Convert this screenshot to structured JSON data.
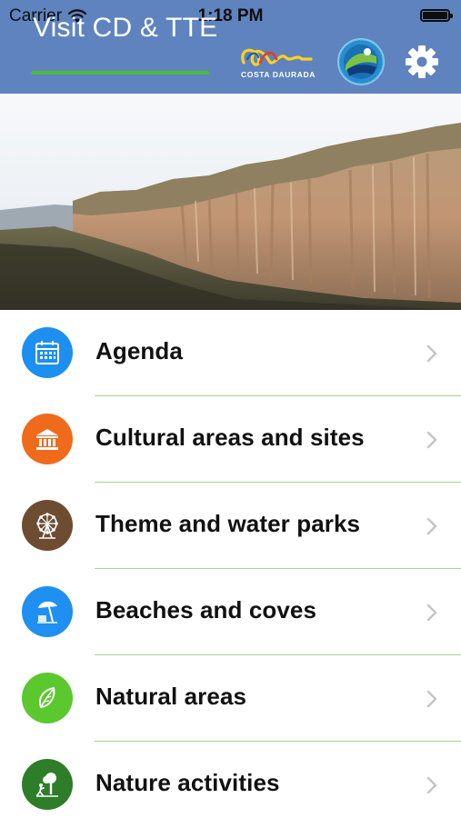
{
  "status_bar": {
    "carrier": "Carrier",
    "time": "1:18 PM"
  },
  "nav": {
    "title": "Visit CD & TTE",
    "logo_text": "COSTA DAURADA",
    "settings_icon": "gear-icon"
  },
  "hero": {
    "image": "rocky-cliff-landscape"
  },
  "menu": {
    "items": [
      {
        "label": "Agenda",
        "icon": "calendar-icon",
        "color": "#1d8ff0"
      },
      {
        "label": "Cultural areas and sites",
        "icon": "museum-icon",
        "color": "#f06a1c"
      },
      {
        "label": "Theme and water parks",
        "icon": "ferris-wheel-icon",
        "color": "#6e4c32"
      },
      {
        "label": "Beaches and coves",
        "icon": "beach-umbrella-icon",
        "color": "#1f8ff2"
      },
      {
        "label": "Natural areas",
        "icon": "leaf-icon",
        "color": "#5bc82e"
      },
      {
        "label": "Nature activities",
        "icon": "tree-walker-icon",
        "color": "#2e7d28"
      }
    ]
  },
  "colors": {
    "nav_background": "#5f83be",
    "accent_green": "#4cba3c",
    "divider": "#9fd88c"
  }
}
